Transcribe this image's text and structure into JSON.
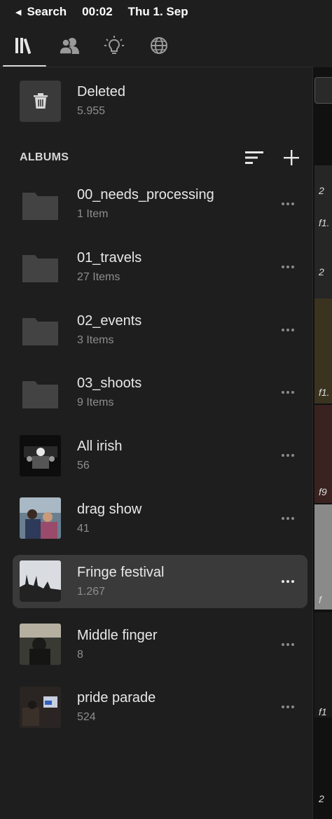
{
  "status": {
    "back": "Search",
    "time": "00:02",
    "date": "Thu 1. Sep"
  },
  "nav": {
    "tabs": [
      {
        "icon": "library-icon",
        "active": true
      },
      {
        "icon": "people-icon",
        "active": false
      },
      {
        "icon": "lightbulb-icon",
        "active": false
      },
      {
        "icon": "globe-icon",
        "active": false
      }
    ]
  },
  "deleted": {
    "title": "Deleted",
    "count": "5.955"
  },
  "albums": {
    "header": "ALBUMS",
    "items": [
      {
        "name": "00_needs_processing",
        "sub": "1 Item",
        "kind": "folder"
      },
      {
        "name": "01_travels",
        "sub": "27 Items",
        "kind": "folder"
      },
      {
        "name": "02_events",
        "sub": "3 Items",
        "kind": "folder"
      },
      {
        "name": "03_shoots",
        "sub": "9 Items",
        "kind": "folder"
      },
      {
        "name": "All irish",
        "sub": "56",
        "kind": "photo"
      },
      {
        "name": "drag show",
        "sub": "41",
        "kind": "photo"
      },
      {
        "name": "Fringe festival",
        "sub": "1.267",
        "kind": "photo",
        "selected": true
      },
      {
        "name": "Middle finger",
        "sub": "8",
        "kind": "photo"
      },
      {
        "name": "pride parade",
        "sub": "524",
        "kind": "photo"
      }
    ]
  },
  "strip": {
    "labels": [
      "2",
      "f1.",
      "2",
      "f1.",
      "f9",
      "f",
      "f1",
      "2"
    ]
  }
}
